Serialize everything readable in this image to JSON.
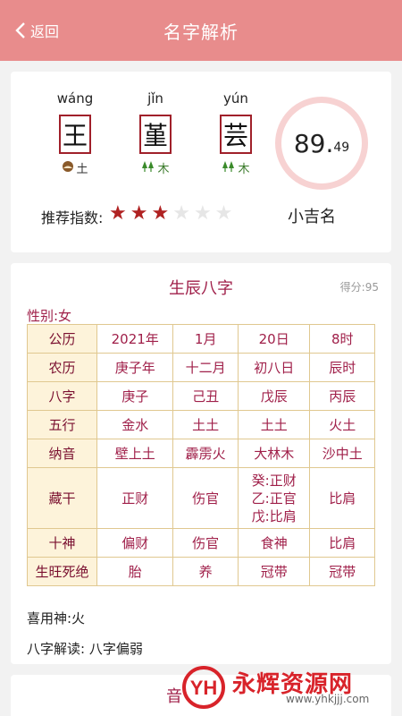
{
  "header": {
    "back_label": "返回",
    "title": "名字解析"
  },
  "name": {
    "chars": [
      {
        "pinyin": "wáng",
        "char": "王",
        "element": "土",
        "element_icon": "earth-icon"
      },
      {
        "pinyin": "jǐn",
        "char": "堇",
        "element": "木",
        "element_icon": "tree-icon"
      },
      {
        "pinyin": "yún",
        "char": "芸",
        "element": "木",
        "element_icon": "tree-icon"
      }
    ],
    "score_int": "89.",
    "score_dec": "49",
    "score_value": 89.49,
    "recommend_label": "推荐指数:",
    "stars_filled": 3,
    "stars_total": 6,
    "level": "小吉名"
  },
  "bazi": {
    "title": "生辰八字",
    "score": "得分:95",
    "gender": "性别:女",
    "rows": [
      {
        "label": "公历",
        "cells": [
          "2021年",
          "1月",
          "20日",
          "8时"
        ]
      },
      {
        "label": "农历",
        "cells": [
          "庚子年",
          "十二月",
          "初八日",
          "辰时"
        ]
      },
      {
        "label": "八字",
        "cells": [
          "庚子",
          "己丑",
          "戊辰",
          "丙辰"
        ]
      },
      {
        "label": "五行",
        "cells": [
          "金水",
          "土土",
          "土土",
          "火土"
        ]
      },
      {
        "label": "纳音",
        "cells": [
          "壁上土",
          "霹雳火",
          "大林木",
          "沙中土"
        ]
      },
      {
        "label": "藏干",
        "cells": [
          "正财",
          "伤官",
          "癸:正财\n乙:正官\n戊:比肩",
          "比肩"
        ]
      },
      {
        "label": "十神",
        "cells": [
          "偏财",
          "伤官",
          "食神",
          "比肩"
        ]
      },
      {
        "label": "生旺死绝",
        "cells": [
          "胎",
          "养",
          "冠带",
          "冠带"
        ]
      }
    ],
    "xiyong": "喜用神:火",
    "jiedu": "八字解读: 八字偏弱"
  },
  "section3": {
    "title": "音"
  },
  "watermark": {
    "text": "永辉资源网",
    "url": "www.yhkjjj.com",
    "logo": "YH"
  },
  "colors": {
    "header_bg": "#e88c8c",
    "accent": "#a0204a",
    "star_on": "#b02222",
    "table_border": "#e0c890"
  }
}
